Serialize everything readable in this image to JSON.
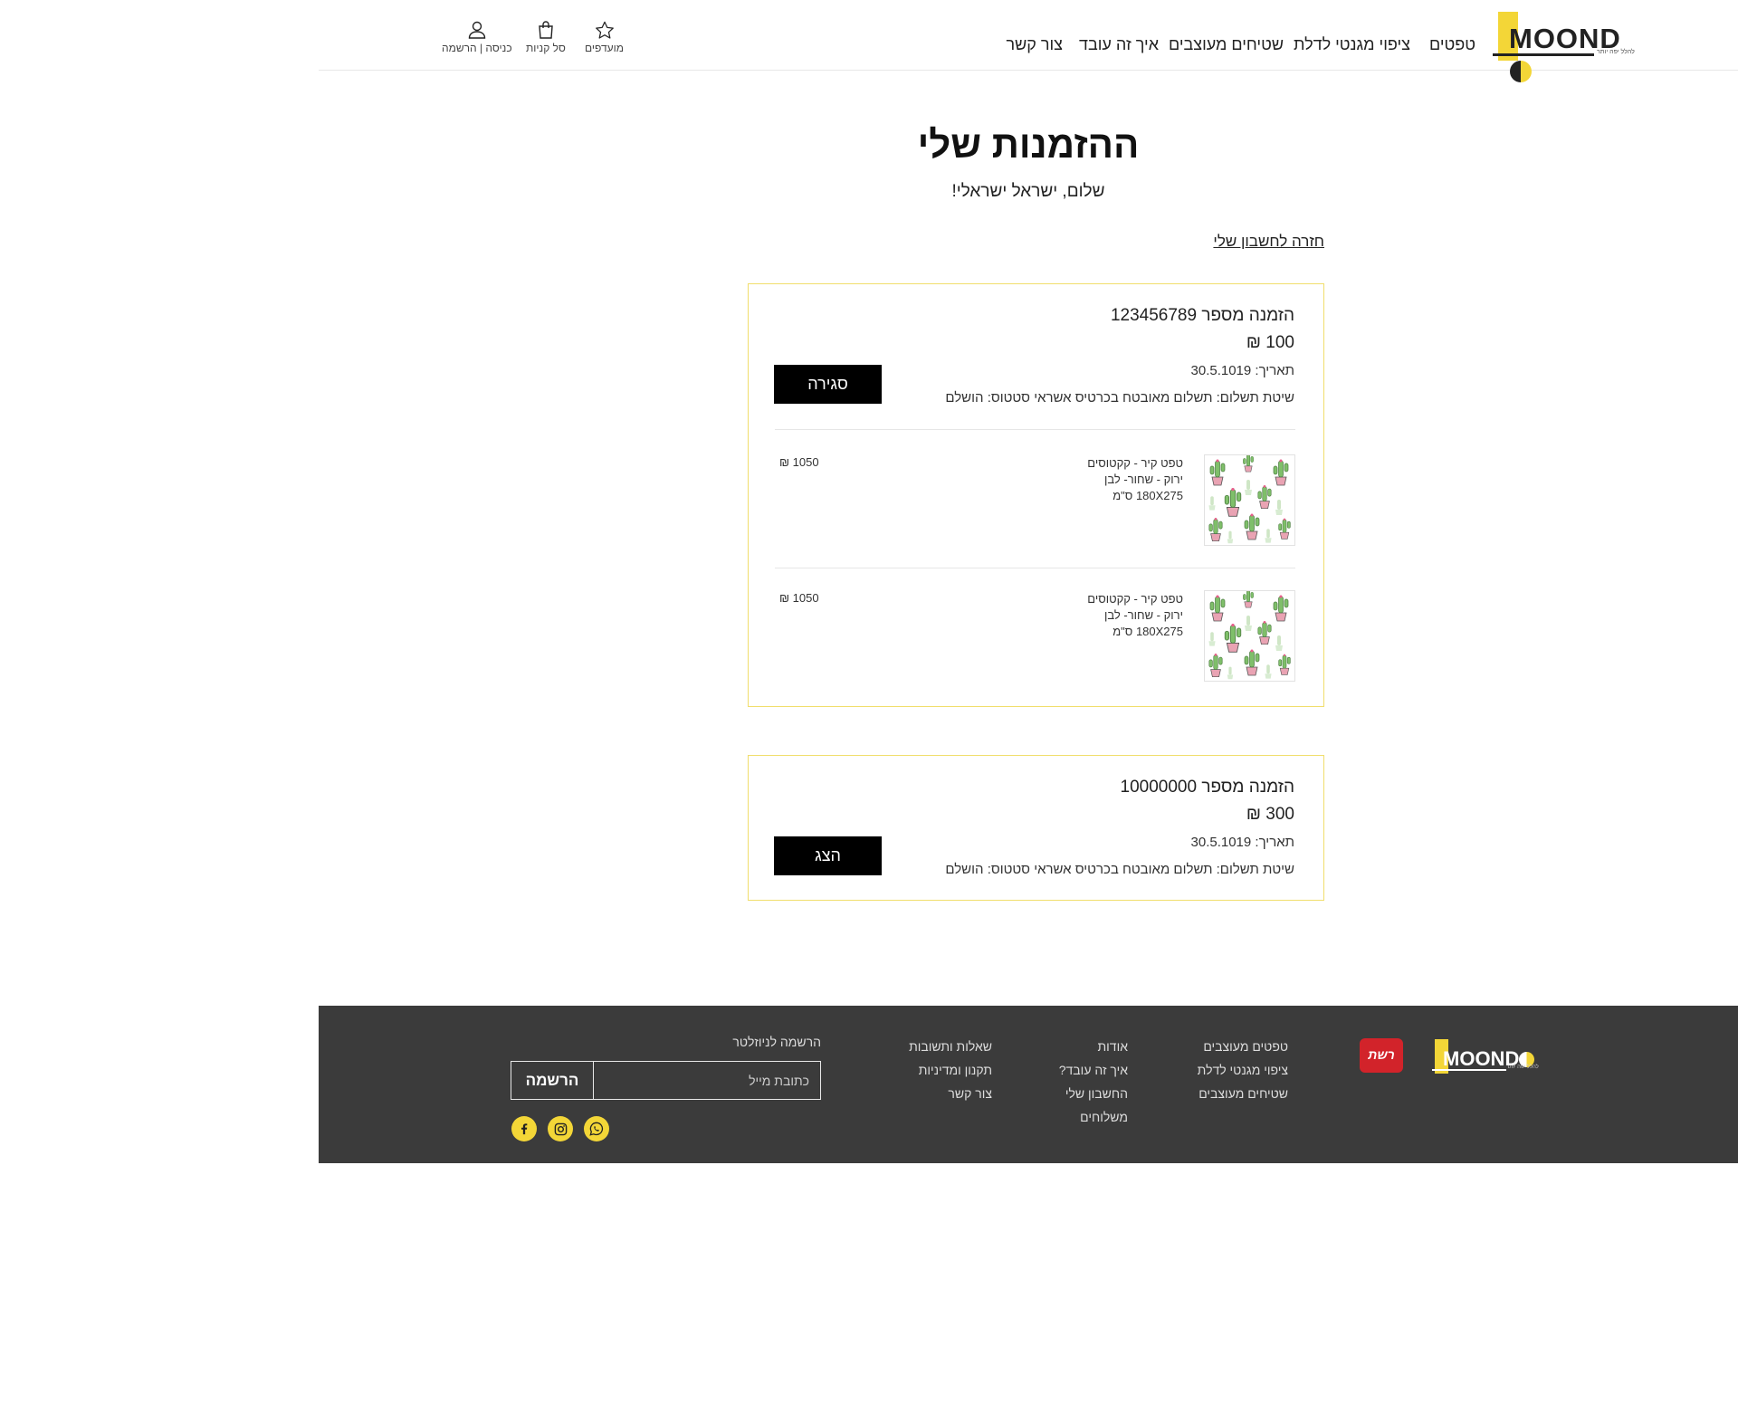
{
  "header": {
    "logo_text": "MOOND",
    "logo_tagline": "להלל יפה יותר",
    "nav": [
      "טפטים",
      "ציפוי מגנטי לדלת",
      "שטיחים מעוצבים",
      "איך זה עובד",
      "צור קשר"
    ],
    "favorites_label": "מועדפים",
    "cart_label": "סל קניות",
    "login_label": "כניסה | הרשמה"
  },
  "main": {
    "title": "ההזמנות שלי",
    "greeting": "שלום, ישראל ישראלי!",
    "back_link": "חזרה לחשבון שלי"
  },
  "orders": [
    {
      "number": "הזמנה מספר 123456789",
      "total": "100 ₪",
      "date": "תאריך: 30.5.1019",
      "payment": "שיטת תשלום: תשלום מאובטח בכרטיס אשראי סטטוס: הושלם",
      "button_label": "סגירה",
      "items": [
        {
          "name": "טפט קיר - קקטוסים",
          "colors": "ירוק - שחור- לבן",
          "size": "180X275 ס\"מ",
          "price": "1050 ₪"
        },
        {
          "name": "טפט קיר - קקטוסים",
          "colors": "ירוק - שחור- לבן",
          "size": "180X275 ס\"מ",
          "price": "1050 ₪"
        }
      ]
    },
    {
      "number": "הזמנה מספר 10000000",
      "total": "300 ₪",
      "date": "תאריך: 30.5.1019",
      "payment": "שיטת תשלום: תשלום מאובטח בכרטיס אשראי סטטוס: הושלם",
      "button_label": "הצג"
    }
  ],
  "footer": {
    "logo_text": "MOOND",
    "logo_tagline": "להלל יפה יותר",
    "badge": "רשת",
    "col1": [
      "טפטים מעוצבים",
      "ציפוי מגנטי לדלת",
      "שטיחים מעוצבים"
    ],
    "col2": [
      "אודות",
      "איך זה עובד?",
      "החשבון שלי",
      "משלוחים"
    ],
    "col3": [
      "שאלות ותשובות",
      "תקנון ומדיניות",
      "צור קשר"
    ],
    "newsletter_title": "הרשמה לניוזלטר",
    "email_placeholder": "כתובת מייל",
    "signup_button": "הרשמה"
  },
  "colors": {
    "accent": "#f3d637",
    "footer_bg": "#3b3b3b",
    "card_border": "#f1de6c"
  },
  "icons": [
    "star-icon",
    "shopping-bag-icon",
    "user-icon",
    "whatsapp-icon",
    "instagram-icon",
    "facebook-icon"
  ]
}
